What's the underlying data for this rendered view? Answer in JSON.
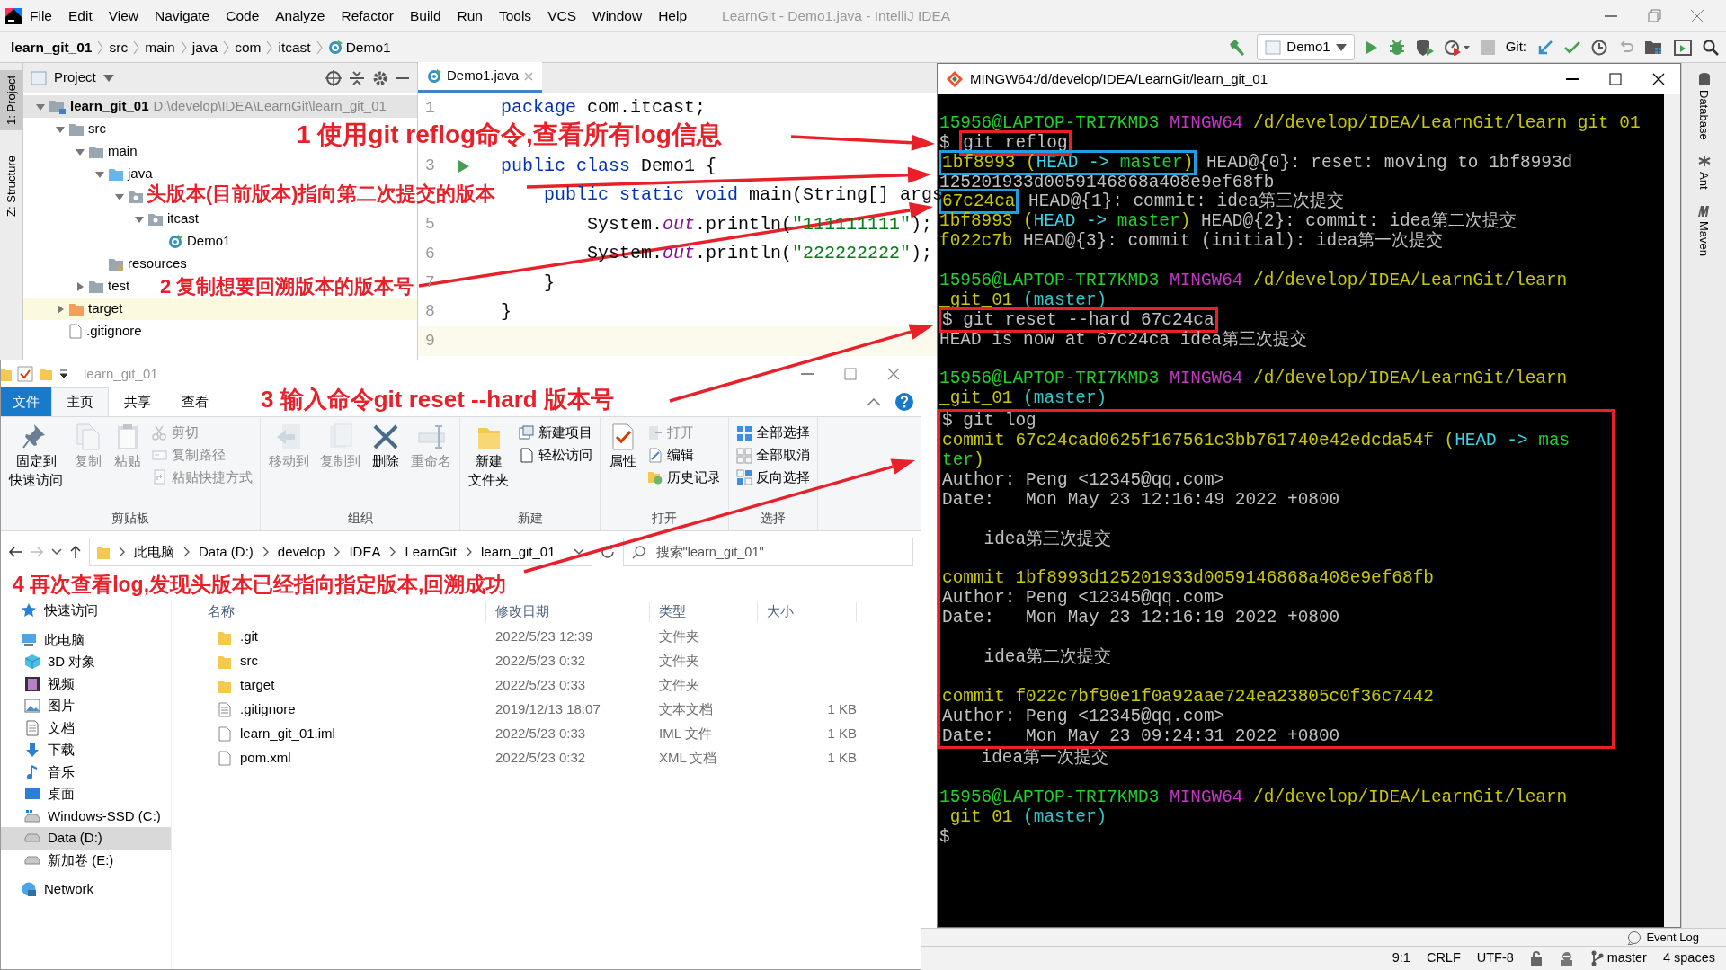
{
  "ide": {
    "title": "LearnGit - Demo1.java - IntelliJ IDEA",
    "menu": [
      "File",
      "Edit",
      "View",
      "Navigate",
      "Code",
      "Analyze",
      "Refactor",
      "Build",
      "Run",
      "Tools",
      "VCS",
      "Window",
      "Help"
    ],
    "breadcrumbs": [
      {
        "label": "learn_git_01",
        "kind": "project"
      },
      {
        "label": "src",
        "kind": "folder"
      },
      {
        "label": "main",
        "kind": "folder"
      },
      {
        "label": "java",
        "kind": "folder"
      },
      {
        "label": "com",
        "kind": "folder"
      },
      {
        "label": "itcast",
        "kind": "folder"
      },
      {
        "label": "Demo1",
        "kind": "class"
      }
    ],
    "toolbar": {
      "run_config": "Demo1",
      "vcs_label": "Git:"
    },
    "left_tabs": [
      {
        "label": "1: Project",
        "selected": true
      },
      {
        "label": "Z: Structure",
        "selected": false
      }
    ],
    "project_panel": {
      "title": "Project",
      "tree": [
        {
          "label": "learn_git_01",
          "path": "D:\\develop\\IDEA\\LearnGit\\learn_git_01",
          "kind": "module",
          "expanded": true,
          "children": [
            {
              "label": "src",
              "kind": "folder",
              "expanded": true,
              "children": [
                {
                  "label": "main",
                  "kind": "folder",
                  "expanded": true,
                  "children": [
                    {
                      "label": "java",
                      "kind": "source",
                      "expanded": true,
                      "children": [
                        {
                          "kind": "package",
                          "expanded": true,
                          "children": [
                            {
                              "label": "itcast",
                              "kind": "package",
                              "expanded": true,
                              "children": [
                                {
                                  "label": "Demo1",
                                  "kind": "class"
                                }
                              ]
                            }
                          ]
                        }
                      ]
                    },
                    {
                      "label": "resources",
                      "kind": "resources"
                    }
                  ]
                },
                {
                  "label": "test",
                  "kind": "folder",
                  "expanded": false
                }
              ]
            },
            {
              "label": "target",
              "kind": "excluded",
              "expanded": false
            },
            {
              "label": ".gitignore",
              "kind": "file"
            }
          ]
        }
      ]
    },
    "editor": {
      "tab": "Demo1.java",
      "lines": [
        {
          "number": "1",
          "runnable": false,
          "current": false,
          "code": [
            {
              "kind": "kw",
              "text": "package"
            },
            {
              "kind": "plain",
              "text": " com.itcast;"
            }
          ]
        },
        {
          "runnable": false,
          "current": false
        },
        {
          "number": "3",
          "runnable": true,
          "current": false,
          "code": [
            {
              "kind": "kw",
              "text": "public class"
            },
            {
              "kind": "plain",
              "text": " Demo1 {"
            }
          ]
        },
        {
          "runnable": false,
          "current": false,
          "code": [
            {
              "kind": "kw",
              "text": "    public static void"
            },
            {
              "kind": "plain",
              "text": " main(String[] args"
            }
          ]
        },
        {
          "number": "5",
          "runnable": false,
          "current": false,
          "code": [
            {
              "kind": "plain",
              "text": "        System."
            },
            {
              "kind": "field",
              "text": "out"
            },
            {
              "kind": "plain",
              "text": ".println("
            },
            {
              "kind": "str",
              "text": "\"111111111\""
            },
            {
              "kind": "plain",
              "text": ");"
            }
          ]
        },
        {
          "number": "6",
          "runnable": false,
          "current": false,
          "code": [
            {
              "kind": "plain",
              "text": "        System."
            },
            {
              "kind": "field",
              "text": "out"
            },
            {
              "kind": "plain",
              "text": ".println("
            },
            {
              "kind": "str",
              "text": "\"222222222\""
            },
            {
              "kind": "plain",
              "text": ");"
            }
          ]
        },
        {
          "number": "7",
          "runnable": false,
          "current": false,
          "code": [
            {
              "kind": "plain",
              "text": "    }"
            }
          ]
        },
        {
          "number": "8",
          "runnable": false,
          "current": false,
          "code": [
            {
              "kind": "plain",
              "text": "}"
            }
          ]
        },
        {
          "number": "9",
          "runnable": false,
          "current": true
        }
      ]
    },
    "right_tabs": [
      "Database",
      "Ant",
      "Maven"
    ],
    "event_log": "Event Log",
    "status": {
      "position": "9:1",
      "line_sep": "CRLF",
      "encoding": "UTF-8",
      "branch": "master",
      "indent": "4 spaces"
    }
  },
  "terminal": {
    "title": "MINGW64:/d/develop/IDEA/LearnGit/learn_git_01",
    "lines": [
      {
        "kind": "blank"
      },
      {
        "kind": "text",
        "segments": [
          {
            "kind": "user",
            "text": "15956@LAPTOP-TRI7KMD3"
          },
          {
            "kind": "host",
            "text": " MINGW64"
          },
          {
            "kind": "path",
            "text": " /d/develop/IDEA/LearnGit/learn_git_01"
          }
        ]
      },
      {
        "kind": "text",
        "segments": [
          {
            "kind": "plain",
            "text": "$ "
          },
          {
            "kind": "frame",
            "color": "#e8202a",
            "parts": [
              {
                "kind": "plain",
                "text": "git reflog"
              }
            ]
          }
        ]
      },
      {
        "kind": "text",
        "segments": [
          {
            "kind": "frame",
            "color": "#1ba1e2",
            "parts": [
              {
                "kind": "hash",
                "text": "1bf8993 ("
              },
              {
                "kind": "head",
                "text": "HEAD -> "
              },
              {
                "kind": "ref",
                "text": "master"
              },
              {
                "kind": "hash",
                "text": ")"
              }
            ]
          },
          {
            "kind": "plain",
            "text": " HEAD@{0}: reset: moving to 1bf8993d"
          }
        ]
      },
      {
        "kind": "text",
        "segments": [
          {
            "kind": "plain",
            "text": "125201933d0059146868a408e9ef68fb"
          }
        ]
      },
      {
        "kind": "text",
        "segments": [
          {
            "kind": "frame",
            "color": "#1ba1e2",
            "parts": [
              {
                "kind": "hash",
                "text": "67c24ca"
              }
            ]
          },
          {
            "kind": "plain",
            "text": " HEAD@{1}: commit: idea第三次提交"
          }
        ]
      },
      {
        "kind": "text",
        "segments": [
          {
            "kind": "hash",
            "text": "1bf8993 ("
          },
          {
            "kind": "head",
            "text": "HEAD -> "
          },
          {
            "kind": "ref",
            "text": "master"
          },
          {
            "kind": "hash",
            "text": ")"
          },
          {
            "kind": "plain",
            "text": " HEAD@{2}: commit: idea第二次提交"
          }
        ]
      },
      {
        "kind": "text",
        "segments": [
          {
            "kind": "hash",
            "text": "f022c7b"
          },
          {
            "kind": "plain",
            "text": " HEAD@{3}: commit (initial): idea第一次提交"
          }
        ]
      },
      {
        "kind": "blank"
      },
      {
        "kind": "text",
        "segments": [
          {
            "kind": "user",
            "text": "15956@LAPTOP-TRI7KMD3"
          },
          {
            "kind": "host",
            "text": " MINGW64"
          },
          {
            "kind": "path",
            "text": " /d/develop/IDEA/LearnGit/learn"
          }
        ]
      },
      {
        "kind": "text",
        "segments": [
          {
            "kind": "path",
            "text": "_git_01"
          },
          {
            "kind": "branch",
            "text": " (master)"
          }
        ]
      },
      {
        "kind": "text",
        "segments": [
          {
            "kind": "frame",
            "color": "#e8202a",
            "parts": [
              {
                "kind": "plain",
                "text": "$ git reset --hard 67c24ca"
              }
            ]
          }
        ]
      },
      {
        "kind": "text",
        "segments": [
          {
            "kind": "plain",
            "text": "HEAD is now at 67c24ca idea第三次提交"
          }
        ]
      },
      {
        "kind": "blank"
      },
      {
        "kind": "text",
        "segments": [
          {
            "kind": "user",
            "text": "15956@LAPTOP-TRI7KMD3"
          },
          {
            "kind": "host",
            "text": " MINGW64"
          },
          {
            "kind": "path",
            "text": " /d/develop/IDEA/LearnGit/learn"
          }
        ]
      },
      {
        "kind": "text",
        "segments": [
          {
            "kind": "path",
            "text": "_git_01"
          },
          {
            "kind": "branch",
            "text": " (master)"
          }
        ]
      },
      {
        "kind": "frame",
        "color": "#e8202a",
        "lines": [
          {
            "kind": "text",
            "segments": [
              {
                "kind": "plain",
                "text": "$ git log"
              }
            ]
          },
          {
            "kind": "text",
            "segments": [
              {
                "kind": "hash",
                "text": "commit 67c24cad0625f167561c3bb761740e42edcda54f ("
              },
              {
                "kind": "head",
                "text": "HEAD -> "
              },
              {
                "kind": "ref",
                "text": "mas"
              }
            ]
          },
          {
            "kind": "text",
            "segments": [
              {
                "kind": "ref",
                "text": "ter"
              },
              {
                "kind": "hash",
                "text": ")"
              }
            ]
          },
          {
            "kind": "text",
            "segments": [
              {
                "kind": "plain",
                "text": "Author: Peng <12345@qq.com>"
              }
            ]
          },
          {
            "kind": "text",
            "segments": [
              {
                "kind": "plain",
                "text": "Date:   Mon May 23 12:16:49 2022 +0800"
              }
            ]
          },
          {
            "kind": "blank"
          },
          {
            "kind": "text",
            "segments": [
              {
                "kind": "plain",
                "text": "    idea第三次提交"
              }
            ]
          },
          {
            "kind": "blank"
          },
          {
            "kind": "text",
            "segments": [
              {
                "kind": "hash",
                "text": "commit 1bf8993d125201933d0059146868a408e9ef68fb"
              }
            ]
          },
          {
            "kind": "text",
            "segments": [
              {
                "kind": "plain",
                "text": "Author: Peng <12345@qq.com>"
              }
            ]
          },
          {
            "kind": "text",
            "segments": [
              {
                "kind": "plain",
                "text": "Date:   Mon May 23 12:16:19 2022 +0800"
              }
            ]
          },
          {
            "kind": "blank"
          },
          {
            "kind": "text",
            "segments": [
              {
                "kind": "plain",
                "text": "    idea第二次提交"
              }
            ]
          },
          {
            "kind": "blank"
          },
          {
            "kind": "text",
            "segments": [
              {
                "kind": "hash",
                "text": "commit f022c7bf90e1f0a92aae724ea23805c0f36c7442"
              }
            ]
          },
          {
            "kind": "text",
            "segments": [
              {
                "kind": "plain",
                "text": "Author: Peng <12345@qq.com>"
              }
            ]
          },
          {
            "kind": "text",
            "segments": [
              {
                "kind": "plain",
                "text": "Date:   Mon May 23 09:24:31 2022 +0800"
              }
            ]
          }
        ]
      },
      {
        "kind": "text",
        "segments": [
          {
            "kind": "plain",
            "text": "    idea第一次提交"
          }
        ]
      },
      {
        "kind": "blank"
      },
      {
        "kind": "text",
        "segments": [
          {
            "kind": "user",
            "text": "15956@LAPTOP-TRI7KMD3"
          },
          {
            "kind": "host",
            "text": " MINGW64"
          },
          {
            "kind": "path",
            "text": " /d/develop/IDEA/LearnGit/learn"
          }
        ]
      },
      {
        "kind": "text",
        "segments": [
          {
            "kind": "path",
            "text": "_git_01"
          },
          {
            "kind": "branch",
            "text": " (master)"
          }
        ]
      },
      {
        "kind": "text",
        "segments": [
          {
            "kind": "plain",
            "text": "$"
          }
        ]
      }
    ]
  },
  "explorer": {
    "title": "learn_git_01",
    "tabs": [
      {
        "label": "文件",
        "kind": "file",
        "selected": false
      },
      {
        "label": "主页",
        "kind": "tab",
        "selected": true
      },
      {
        "label": "共享",
        "kind": "tab",
        "selected": false
      },
      {
        "label": "查看",
        "kind": "tab",
        "selected": false
      }
    ],
    "ribbon": [
      {
        "label": "剪贴板",
        "items": [
          {
            "kind": "large",
            "label_lines": [
              "固定到",
              "快速访问"
            ],
            "disabled": false
          },
          {
            "kind": "large",
            "label": "复制",
            "disabled": true
          },
          {
            "kind": "large",
            "label": "粘贴",
            "disabled": true
          },
          {
            "kind": "small",
            "label": "剪切",
            "disabled": true
          },
          {
            "kind": "small",
            "label": "复制路径",
            "disabled": true
          },
          {
            "kind": "small",
            "label": "粘贴快捷方式",
            "disabled": true
          }
        ]
      },
      {
        "label": "组织",
        "items": [
          {
            "kind": "large",
            "label": "移动到",
            "disabled": true
          },
          {
            "kind": "large",
            "label": "复制到",
            "disabled": true
          },
          {
            "kind": "large",
            "label": "删除",
            "disabled": false
          },
          {
            "kind": "large",
            "label": "重命名",
            "disabled": true
          }
        ]
      },
      {
        "label": "新建",
        "items": [
          {
            "kind": "large",
            "label_lines": [
              "新建",
              "文件夹"
            ],
            "disabled": false
          },
          {
            "kind": "small",
            "label": "新建项目",
            "disabled": false
          },
          {
            "kind": "small",
            "label": "轻松访问",
            "disabled": false
          }
        ]
      },
      {
        "label": "打开",
        "items": [
          {
            "kind": "large",
            "label": "属性",
            "disabled": false
          },
          {
            "kind": "small",
            "label": "打开",
            "disabled": true
          },
          {
            "kind": "small",
            "label": "编辑",
            "disabled": false
          },
          {
            "kind": "small",
            "label": "历史记录",
            "disabled": false
          }
        ]
      },
      {
        "label": "选择",
        "items": [
          {
            "kind": "small",
            "label": "全部选择",
            "disabled": false
          },
          {
            "kind": "small",
            "label": "全部取消",
            "disabled": false
          },
          {
            "kind": "small",
            "label": "反向选择",
            "disabled": false
          }
        ]
      }
    ],
    "address": [
      "此电脑",
      "Data (D:)",
      "develop",
      "IDEA",
      "LearnGit",
      "learn_git_01"
    ],
    "search": {
      "placeholder": "搜索\"learn_git_01\""
    },
    "nav": [
      {
        "label": "快速访问",
        "selected": false
      },
      {
        "label": "此电脑",
        "selected": false,
        "children": [
          {
            "label": "3D 对象",
            "selected": false
          },
          {
            "label": "视频",
            "selected": false
          },
          {
            "label": "图片",
            "selected": false
          },
          {
            "label": "文档",
            "selected": false
          },
          {
            "label": "下载",
            "selected": false
          },
          {
            "label": "音乐",
            "selected": false
          },
          {
            "label": "桌面",
            "selected": false
          },
          {
            "label": "Windows-SSD (C:)",
            "selected": false
          },
          {
            "label": "Data (D:)",
            "selected": true
          },
          {
            "label": "新加卷 (E:)",
            "selected": false
          }
        ]
      },
      {
        "label": "Network",
        "selected": false
      }
    ],
    "columns": [
      "名称",
      "修改日期",
      "类型",
      "大小"
    ],
    "files": [
      {
        "kind": "folder",
        "name": ".git",
        "modified": "2022/5/23 12:39",
        "type": "文件夹"
      },
      {
        "kind": "folder",
        "name": "src",
        "modified": "2022/5/23 0:32",
        "type": "文件夹"
      },
      {
        "kind": "folder",
        "name": "target",
        "modified": "2022/5/23 0:33",
        "type": "文件夹"
      },
      {
        "kind": "text",
        "name": ".gitignore",
        "modified": "2019/12/13 18:07",
        "type": "文本文档",
        "size": "1 KB"
      },
      {
        "kind": "file",
        "name": "learn_git_01.iml",
        "modified": "2022/5/23 0:33",
        "type": "IML 文件",
        "size": "1 KB"
      },
      {
        "kind": "file",
        "name": "pom.xml",
        "modified": "2022/5/23 0:32",
        "type": "XML 文档",
        "size": "1 KB"
      }
    ]
  },
  "annotations": [
    {
      "text": "1 使用git reflog命令,查看所有log信息"
    },
    {
      "text": "头版本(目前版本)指向第二次提交的版本"
    },
    {
      "text": "2 复制想要回溯版本的版本号"
    },
    {
      "text": "3 输入命令git reset --hard 版本号"
    },
    {
      "text": "4 再次查看log,发现头版本已经指向指定版本,回溯成功"
    }
  ]
}
